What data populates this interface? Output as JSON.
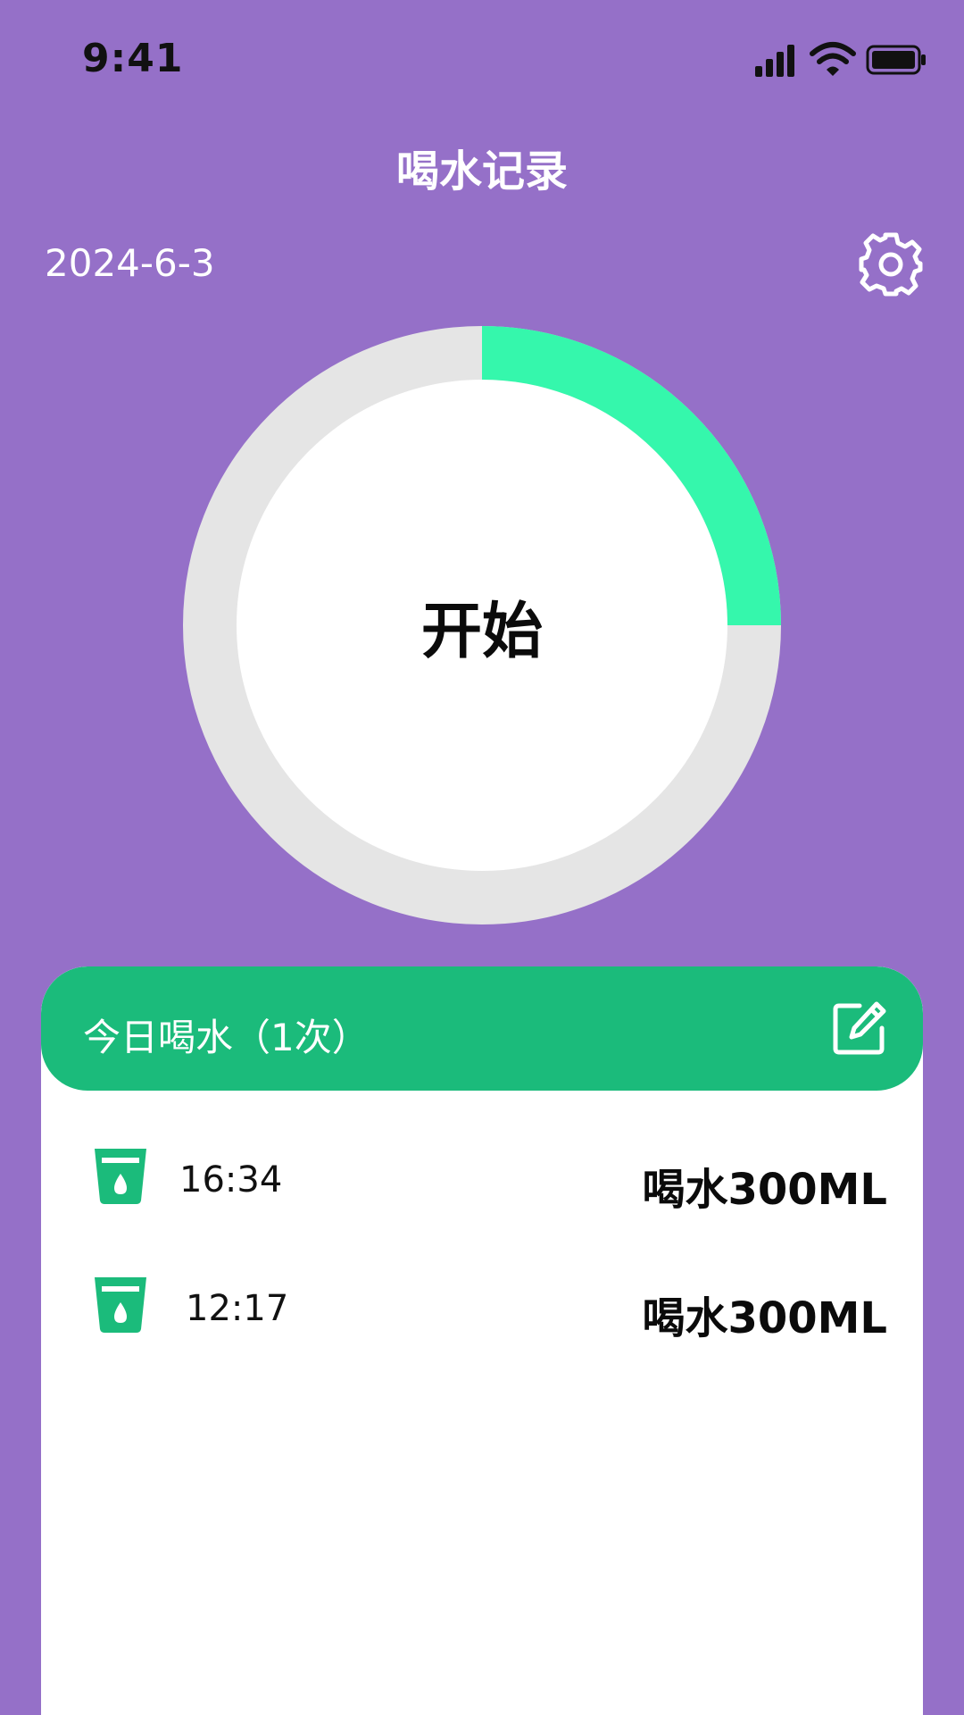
{
  "status_bar": {
    "time": "9:41",
    "icons": [
      "cellular-signal-icon",
      "wifi-icon",
      "battery-icon"
    ]
  },
  "header": {
    "title": "喝水记录",
    "date": "2024-6-3",
    "settings_icon": "gear-icon"
  },
  "progress": {
    "button_label": "开始",
    "fraction": 0.25,
    "progress_color": "#35f7ac",
    "track_color": "#e5e5e5"
  },
  "records": {
    "title": "今日喝水（1次）",
    "edit_icon": "edit-icon",
    "header_color": "#1bbb7b",
    "items": [
      {
        "time": "16:34",
        "amount": "喝水300ML",
        "icon": "cup-icon"
      },
      {
        "time": "12:17",
        "amount": "喝水300ML",
        "icon": "cup-icon"
      }
    ]
  },
  "theme": {
    "background": "#9570c8"
  }
}
